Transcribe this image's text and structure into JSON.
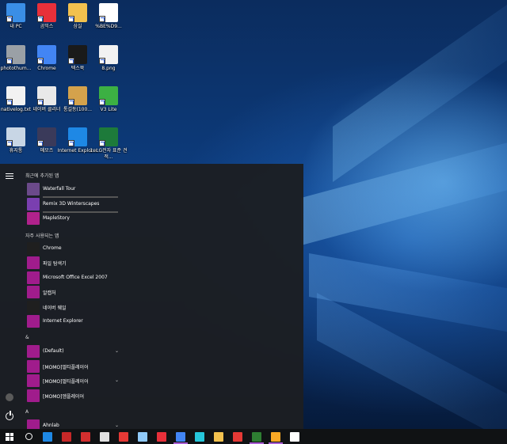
{
  "desktop": {
    "icons": [
      {
        "label": "내 PC",
        "icon": "computer-icon",
        "color": "#3a8ee6"
      },
      {
        "label": "곰믹스",
        "icon": "gom-mix-icon",
        "color": "#e8303a"
      },
      {
        "label": "삼실",
        "icon": "folder-icon",
        "color": "#f2c14e"
      },
      {
        "label": "%BE%D9...",
        "icon": "blank-file-icon",
        "color": "#ffffff"
      },
      {
        "label": "photothum...",
        "icon": "gear-file-icon",
        "color": "#9aa0a6"
      },
      {
        "label": "Chrome",
        "icon": "chrome-icon",
        "color": "#4285f4"
      },
      {
        "label": "텍스북",
        "icon": "textbook-icon",
        "color": "#1a1a1a"
      },
      {
        "label": "8.png",
        "icon": "image-file-icon",
        "color": "#f2f2f2"
      },
      {
        "label": "nativelog.txt",
        "icon": "text-file-icon",
        "color": "#f2f2f2"
      },
      {
        "label": "네이버 클리너",
        "icon": "naver-cleaner-icon",
        "color": "#e9e9e9"
      },
      {
        "label": "통길동(100...",
        "icon": "cd-icon",
        "color": "#d4a24c"
      },
      {
        "label": "V3 Lite",
        "icon": "v3-lite-icon",
        "color": "#3cb043"
      },
      {
        "label": "휴지통",
        "icon": "recycle-bin-icon",
        "color": "#c8d6e5"
      },
      {
        "label": "메모즈",
        "icon": "memoz-icon",
        "color": "#3a3a5a"
      },
      {
        "label": "Internet Explorer",
        "icon": "ie-icon",
        "color": "#1e88e5"
      },
      {
        "label": "1. LG전자 표준 견적...",
        "icon": "excel-icon",
        "color": "#1d7a3a"
      }
    ]
  },
  "start_menu": {
    "recent_header": "최근에 추가된 앱",
    "recent": [
      {
        "label": "Waterfall Tour",
        "icon": "waterfall-tour-icon",
        "color": "#6b4a8a",
        "bar": true
      },
      {
        "label": "Remix 3D Winterscapes",
        "icon": "remix-3d-icon",
        "color": "#7a3fb0",
        "bar": true
      },
      {
        "label": "MapleStory",
        "icon": "maplestory-icon",
        "color": "#b0228c",
        "bar": false
      }
    ],
    "frequent_header": "자주 사용되는 앱",
    "frequent": [
      {
        "label": "Chrome",
        "icon": "chrome-icon",
        "color": "#1f1f1f"
      },
      {
        "label": "파일 탐색기",
        "icon": "file-explorer-icon",
        "color": "#a01c8c"
      },
      {
        "label": "Microsoft Office Excel 2007",
        "icon": "excel-icon",
        "color": "#a01c8c"
      },
      {
        "label": "알캡처",
        "icon": "alcapture-icon",
        "color": "#a01c8c"
      },
      {
        "label": "네이버 웨일",
        "icon": "naver-whale-icon",
        "color": "#1f1f1f"
      },
      {
        "label": "Internet Explorer",
        "icon": "ie-icon",
        "color": "#a01c8c"
      }
    ],
    "amp_header": "&",
    "amp": [
      {
        "label": "(Default)",
        "icon": "folder-icon",
        "color": "#a01c8c",
        "chev": "⌄"
      },
      {
        "label": "[MOMO]멀티플레이어",
        "icon": "momo-multi-icon",
        "color": "#a01c8c",
        "chev": ""
      },
      {
        "label": "[MOMO]멀티플레이어",
        "icon": "folder-icon",
        "color": "#a01c8c",
        "chev": "⌄"
      },
      {
        "label": "[MOMO]엠플레이어",
        "icon": "momo-player-icon",
        "color": "#a01c8c",
        "chev": ""
      }
    ],
    "a_header": "A",
    "a": [
      {
        "label": "Ahnlab",
        "icon": "folder-icon",
        "color": "#a01c8c",
        "chev": "⌄"
      }
    ]
  },
  "taskbar": {
    "apps": [
      {
        "icon": "search-icon",
        "color": "#ffffff",
        "active": false
      },
      {
        "icon": "ie-icon",
        "color": "#1e88e5",
        "active": false
      },
      {
        "icon": "app-red-grid-icon",
        "color": "#c62828",
        "active": false
      },
      {
        "icon": "app-sync-icon",
        "color": "#d32f2f",
        "active": false
      },
      {
        "icon": "app-gear-icon",
        "color": "#e0e0e0",
        "active": false
      },
      {
        "icon": "record-icon",
        "color": "#e53935",
        "active": false
      },
      {
        "icon": "app-blue-doc-icon",
        "color": "#90caf9",
        "active": false
      },
      {
        "icon": "gom-mix-icon",
        "color": "#e8303a",
        "active": false
      },
      {
        "icon": "chrome-icon",
        "color": "#4285f4",
        "active": true
      },
      {
        "icon": "naver-whale-icon",
        "color": "#26c6da",
        "active": false
      },
      {
        "icon": "file-explorer-icon",
        "color": "#f2c14e",
        "active": false
      },
      {
        "icon": "app-red-icon",
        "color": "#e53935",
        "active": false
      },
      {
        "icon": "excel-icon",
        "color": "#2e7d32",
        "active": true
      },
      {
        "icon": "app-smile-icon",
        "color": "#f9a825",
        "active": true
      },
      {
        "icon": "settings-gear-icon",
        "color": "#ffffff",
        "active": false
      }
    ]
  }
}
